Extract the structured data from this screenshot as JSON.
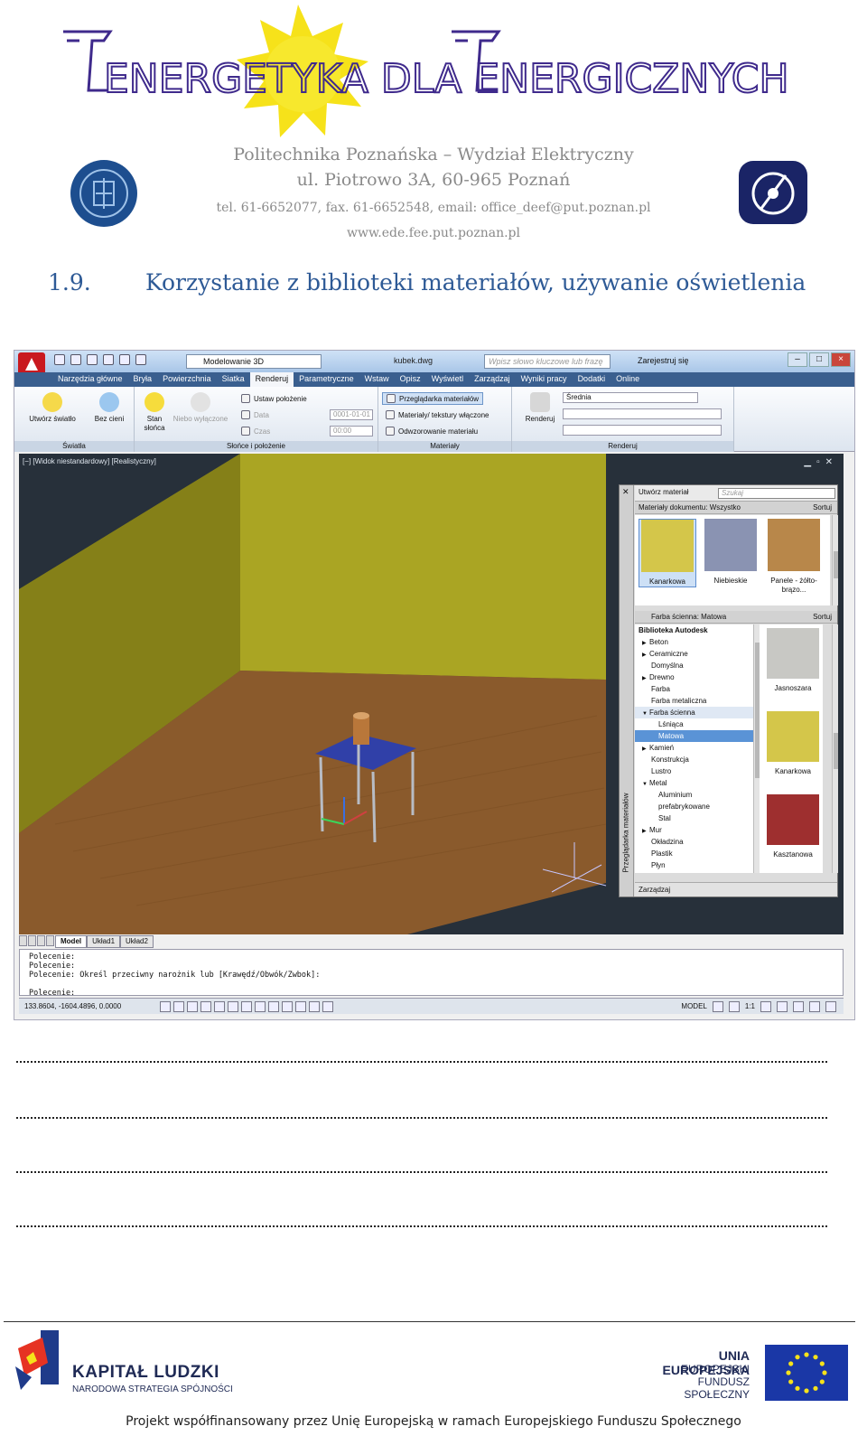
{
  "header": {
    "logo_text": "ENERGETYKA DLA ENERGICZNYCH",
    "university": "Politechnika Poznańska – Wydział Elektryczny",
    "address": "ul. Piotrowo 3A, 60-965 Poznań",
    "contact": "tel.  61-6652077, fax. 61-6652548, email:  office_deef@put.poznan.pl",
    "website": "www.ede.fee.put.poznan.pl"
  },
  "section": {
    "number": "1.9.",
    "title": "Korzystanie z biblioteki materiałów, używanie oświetlenia"
  },
  "autocad": {
    "workspace": "Modelowanie 3D",
    "file_name": "kubek.dwg",
    "search_placeholder": "Wpisz słowo kluczowe lub frazę",
    "sign_in": "Zarejestruj się",
    "tabs": [
      "Narzędzia główne",
      "Bryła",
      "Powierzchnia",
      "Siatka",
      "Renderuj",
      "Parametryczne",
      "Wstaw",
      "Opisz",
      "Wyświetl",
      "Zarządzaj",
      "Wyniki pracy",
      "Dodatki",
      "Online"
    ],
    "active_tab": "Renderuj",
    "ribbon": {
      "create_light": "Utwórz światło",
      "no_shadows": "Bez cieni",
      "sun_status_1": "Stan",
      "sun_status_2": "słońca",
      "sky_off": "Niebo wyłączone",
      "set_location": "Ustaw położenie",
      "date_label": "Data",
      "date_value": "0001-01-01",
      "time_label": "Czas",
      "time_value": "00:00",
      "materials_browser": "Przeglądarka materiałów",
      "materials_textures": "Materiały/ tekstury włączone",
      "material_mapping": "Odwzorowanie materiału",
      "render": "Renderuj",
      "quality": "Średnia",
      "panel_lights": "Światła",
      "panel_sun": "Słońce i położenie",
      "panel_materials": "Materiały",
      "panel_render": "Renderuj"
    },
    "viewport_label": "[−] [Widok niestandardowy] [Realistyczny]",
    "material_browser": {
      "title": "Przeglądarka materiałów",
      "create": "Utwórz materiał",
      "search_placeholder": "Szukaj",
      "doc_materials": "Materiały dokumentu: Wszystko",
      "sort": "Sortuj",
      "doc_swatches": [
        {
          "name": "Kanarkowa",
          "color": "#d4c64a"
        },
        {
          "name": "Niebieskie",
          "color": "#8a93b2"
        },
        {
          "name": "Panele - żółto-brązo...",
          "color": "#b8874a"
        }
      ],
      "library_bar": "Farba ścienna: Matowa",
      "tree": [
        {
          "label": "Biblioteka Autodesk",
          "level": 0
        },
        {
          "label": "Beton",
          "level": 1,
          "arrow": true
        },
        {
          "label": "Ceramiczne",
          "level": 1,
          "arrow": true
        },
        {
          "label": "Domyślna",
          "level": 1
        },
        {
          "label": "Drewno",
          "level": 1,
          "arrow": true
        },
        {
          "label": "Farba",
          "level": 1
        },
        {
          "label": "Farba metaliczna",
          "level": 1
        },
        {
          "label": "Farba ścienna",
          "level": 1,
          "open": true,
          "hover": true
        },
        {
          "label": "Lśniąca",
          "level": 2
        },
        {
          "label": "Matowa",
          "level": 2,
          "selected": true
        },
        {
          "label": "Kamień",
          "level": 1,
          "arrow": true
        },
        {
          "label": "Konstrukcja",
          "level": 1
        },
        {
          "label": "Lustro",
          "level": 1
        },
        {
          "label": "Metal",
          "level": 1,
          "open": true
        },
        {
          "label": "Aluminium",
          "level": 2
        },
        {
          "label": "prefabrykowane",
          "level": 2
        },
        {
          "label": "Stal",
          "level": 2
        },
        {
          "label": "Mur",
          "level": 1,
          "arrow": true
        },
        {
          "label": "Okładzina",
          "level": 1
        },
        {
          "label": "Plastik",
          "level": 1
        },
        {
          "label": "Płyn",
          "level": 1
        }
      ],
      "library_swatches": [
        {
          "name": "Jasnoszara",
          "color": "#c8c8c4"
        },
        {
          "name": "Kanarkowa",
          "color": "#d4c64a"
        },
        {
          "name": "Kasztanowa",
          "color": "#9e2f2f"
        }
      ],
      "manage": "Zarządzaj"
    },
    "layout_tabs": [
      "Model",
      "Układ1",
      "Układ2"
    ],
    "command_lines": [
      "Polecenie:",
      "Polecenie:",
      "Polecenie: Określ przeciwny narożnik lub [Krawędź/Obwók/Zwbok]:",
      "",
      "Polecenie:"
    ],
    "coordinates": "133.8604, -1604.4896, 0.0000",
    "model_label": "MODEL",
    "scale": "1:1"
  },
  "footer": {
    "kl_title": "KAPITAŁ LUDZKI",
    "kl_subtitle": "NARODOWA STRATEGIA SPÓJNOŚCI",
    "eu_1": "UNIA EUROPEJSKA",
    "eu_2": "EUROPEJSKI",
    "eu_3": "FUNDUSZ SPOŁECZNY",
    "note": "Projekt współfinansowany przez Unię Europejską w ramach Europejskiego Funduszu Społecznego"
  },
  "colors": {
    "title_blue": "#2e5a96",
    "logo_purple": "#3f2a8c",
    "sun_yellow": "#f6e21a",
    "wall": "#aaa523",
    "floor": "#8a5a2c"
  }
}
